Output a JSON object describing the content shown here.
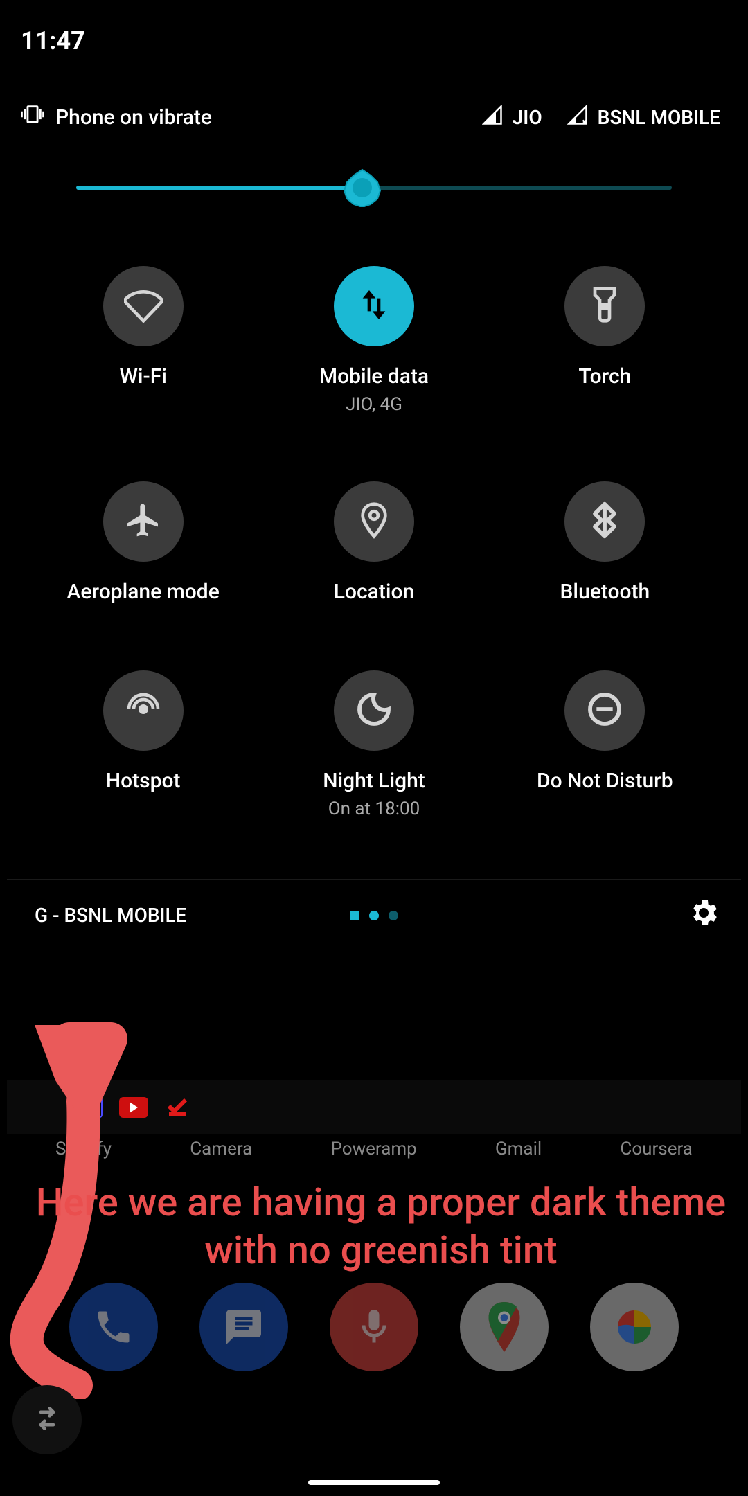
{
  "status": {
    "time": "11:47"
  },
  "panel": {
    "header": {
      "phone_status": "Phone on vibrate",
      "carriers": [
        {
          "name": "JIO",
          "signal_icon": "signal-full"
        },
        {
          "name": "BSNL MOBILE",
          "signal_icon": "signal-no-data"
        }
      ]
    },
    "brightness_percent": 48,
    "tiles": [
      {
        "id": "wifi",
        "label": "Wi-Fi",
        "sub": "",
        "active": false
      },
      {
        "id": "mobile-data",
        "label": "Mobile data",
        "sub": "JIO, 4G",
        "active": true
      },
      {
        "id": "torch",
        "label": "Torch",
        "sub": "",
        "active": false
      },
      {
        "id": "aeroplane",
        "label": "Aeroplane mode",
        "sub": "",
        "active": false
      },
      {
        "id": "location",
        "label": "Location",
        "sub": "",
        "active": false
      },
      {
        "id": "bluetooth",
        "label": "Bluetooth",
        "sub": "",
        "active": false
      },
      {
        "id": "hotspot",
        "label": "Hotspot",
        "sub": "",
        "active": false
      },
      {
        "id": "night-light",
        "label": "Night Light",
        "sub": "On at 18:00",
        "active": false
      },
      {
        "id": "dnd",
        "label": "Do Not Disturb",
        "sub": "",
        "active": false
      }
    ],
    "footer_carrier": "G - BSNL MOBILE",
    "page_count": 3,
    "current_page": 0
  },
  "dock_labels": [
    "Spotify",
    "Camera",
    "Poweramp",
    "Gmail",
    "Coursera"
  ],
  "annotation_text": "Here we are having a proper dark theme with no greenish tint",
  "colors": {
    "accent": "#1bb9d4",
    "annotation": "#ea4e4e"
  }
}
